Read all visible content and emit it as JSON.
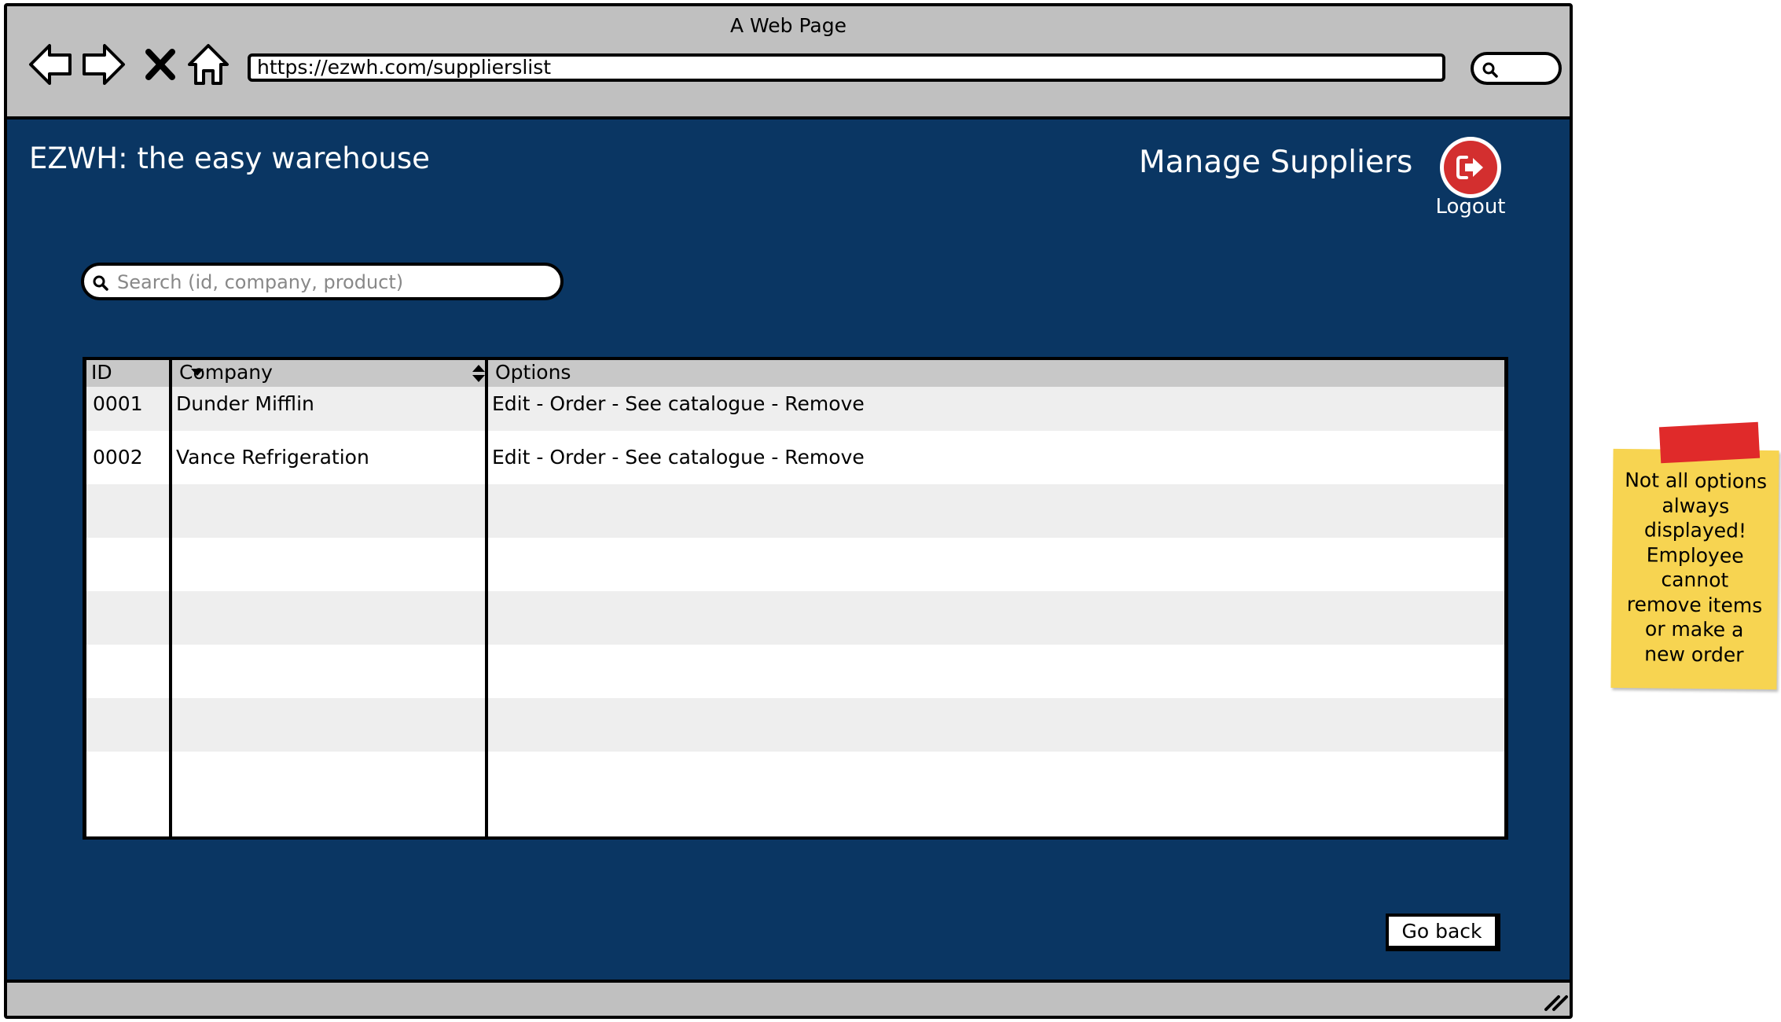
{
  "window": {
    "title": "A Web Page",
    "url": "https://ezwh.com/supplierslist"
  },
  "header": {
    "brand": "EZWH: the easy warehouse",
    "page_title": "Manage Suppliers",
    "logout_label": "Logout"
  },
  "search": {
    "placeholder": "Search (id, company, product)",
    "value": ""
  },
  "table": {
    "columns": [
      "ID",
      "Company",
      "Options"
    ],
    "rows": [
      {
        "id": "0001",
        "company": "Dunder Mifflin",
        "options": "Edit - Order - See catalogue - Remove"
      },
      {
        "id": "0002",
        "company": "Vance Refrigeration",
        "options": "Edit - Order - See catalogue - Remove"
      }
    ],
    "empty_rows": 6
  },
  "footer": {
    "go_back_label": "Go back"
  },
  "note": {
    "lines": [
      "Not all options",
      "always",
      "displayed!",
      "Employee",
      "cannot",
      "remove items",
      "or make a",
      "new order"
    ]
  },
  "colors": {
    "content_bg": "#0a3663",
    "chrome_bg": "#c0c0c0",
    "logout_red": "#d32f2f",
    "note_yellow": "#f7d451",
    "tape_red": "#e02a2a"
  },
  "icons": [
    "back-arrow-icon",
    "forward-arrow-icon",
    "stop-icon",
    "home-icon",
    "search-icon",
    "logout-icon",
    "sort-desc-icon",
    "sort-both-icon",
    "resize-grip-icon"
  ]
}
